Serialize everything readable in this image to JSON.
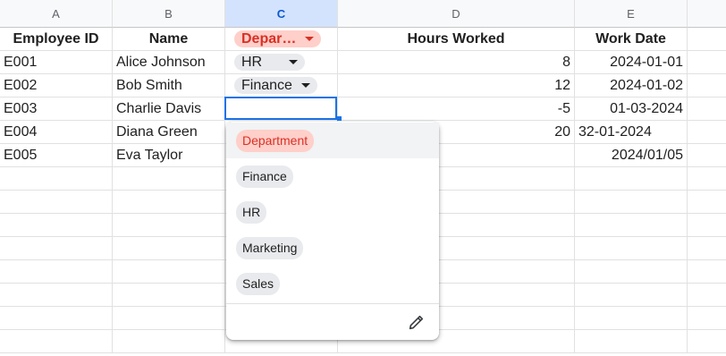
{
  "columns": [
    "A",
    "B",
    "C",
    "D",
    "E"
  ],
  "headers": {
    "employee_id": "Employee ID",
    "name": "Name",
    "department": "Depar…",
    "hours": "Hours Worked",
    "work_date": "Work Date"
  },
  "rows": [
    {
      "id": "E001",
      "name": "Alice Johnson",
      "dept": "HR",
      "hours": "8",
      "date": "2024-01-01"
    },
    {
      "id": "E002",
      "name": "Bob Smith",
      "dept": "Finance",
      "hours": "12",
      "date": "2024-01-02"
    },
    {
      "id": "E003",
      "name": "Charlie Davis",
      "dept": "",
      "hours": "-5",
      "date": "01-03-2024"
    },
    {
      "id": "E004",
      "name": "Diana Green",
      "dept": "",
      "hours": "20",
      "date": "32-01-2024"
    },
    {
      "id": "E005",
      "name": "Eva Taylor",
      "dept": "",
      "hours": "",
      "date": "2024/01/05"
    }
  ],
  "dropdown": {
    "options": [
      "Department",
      "Finance",
      "HR",
      "Marketing",
      "Sales"
    ],
    "edit_icon": "pencil-icon"
  },
  "colors": {
    "selection": "#1a73e8",
    "error_chip_bg": "#ffcfc9",
    "error_chip_text": "#d93025"
  }
}
